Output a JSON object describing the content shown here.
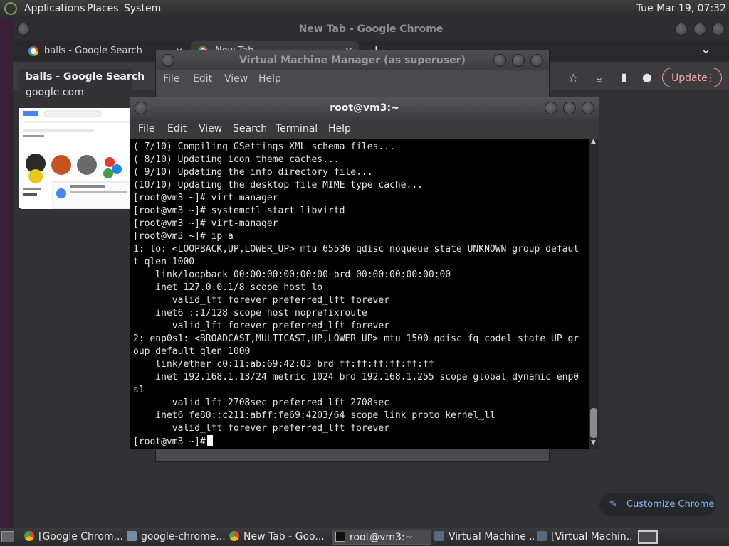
{
  "top_panel": {
    "menus": [
      "Applications",
      "Places",
      "System"
    ],
    "clock": "Tue Mar 19, 07:32"
  },
  "chrome": {
    "title": "New Tab - Google Chrome",
    "tabs": [
      {
        "label": "balls - Google Search",
        "close": "×"
      },
      {
        "label": "New Tab",
        "close": "×"
      }
    ],
    "new_tab": "+",
    "tab_dropdown": "⌄",
    "update_label": "Update",
    "hover_card": {
      "title": "balls - Google Search",
      "url": "google.com"
    },
    "customize_label": "Customize Chrome",
    "accent": "#8ab4f8"
  },
  "vmm": {
    "title": "Virtual Machine Manager (as superuser)",
    "menus": [
      "File",
      "Edit",
      "View",
      "Help"
    ]
  },
  "terminal": {
    "title": "root@vm3:~",
    "menus": [
      "File",
      "Edit",
      "View",
      "Search",
      "Terminal",
      "Help"
    ],
    "lines": [
      "( 7/10) Compiling GSettings XML schema files...",
      "( 8/10) Updating icon theme caches...",
      "( 9/10) Updating the info directory file...",
      "(10/10) Updating the desktop file MIME type cache...",
      "[root@vm3 ~]# virt-manager",
      "[root@vm3 ~]# systemctl start libvirtd",
      "[root@vm3 ~]# virt-manager",
      "[root@vm3 ~]# ip a",
      "1: lo: <LOOPBACK,UP,LOWER_UP> mtu 65536 qdisc noqueue state UNKNOWN group defaul",
      "t qlen 1000",
      "    link/loopback 00:00:00:00:00:00 brd 00:00:00:00:00:00",
      "    inet 127.0.0.1/8 scope host lo",
      "       valid_lft forever preferred_lft forever",
      "    inet6 ::1/128 scope host noprefixroute",
      "       valid_lft forever preferred_lft forever",
      "2: enp0s1: <BROADCAST,MULTICAST,UP,LOWER_UP> mtu 1500 qdisc fq_codel state UP gr",
      "oup default qlen 1000",
      "    link/ether c0:11:ab:69:42:03 brd ff:ff:ff:ff:ff:ff",
      "    inet 192.168.1.13/24 metric 1024 brd 192.168.1.255 scope global dynamic enp0",
      "s1",
      "       valid_lft 2708sec preferred_lft 2708sec",
      "    inet6 fe80::c211:abff:fe69:4203/64 scope link proto kernel_ll",
      "       valid_lft forever preferred_lft forever"
    ],
    "prompt": "[root@vm3 ~]#"
  },
  "taskbar": {
    "items": [
      {
        "label": "[Google Chrom...",
        "icon": "chrome-icon"
      },
      {
        "label": "google-chrome...",
        "icon": "package-icon"
      },
      {
        "label": "New Tab - Goo...",
        "icon": "chrome-icon"
      },
      {
        "label": "root@vm3:~",
        "icon": "terminal-icon"
      },
      {
        "label": "Virtual Machine ...",
        "icon": "vmm-icon"
      },
      {
        "label": "[Virtual Machin...",
        "icon": "vmm-icon"
      }
    ]
  }
}
